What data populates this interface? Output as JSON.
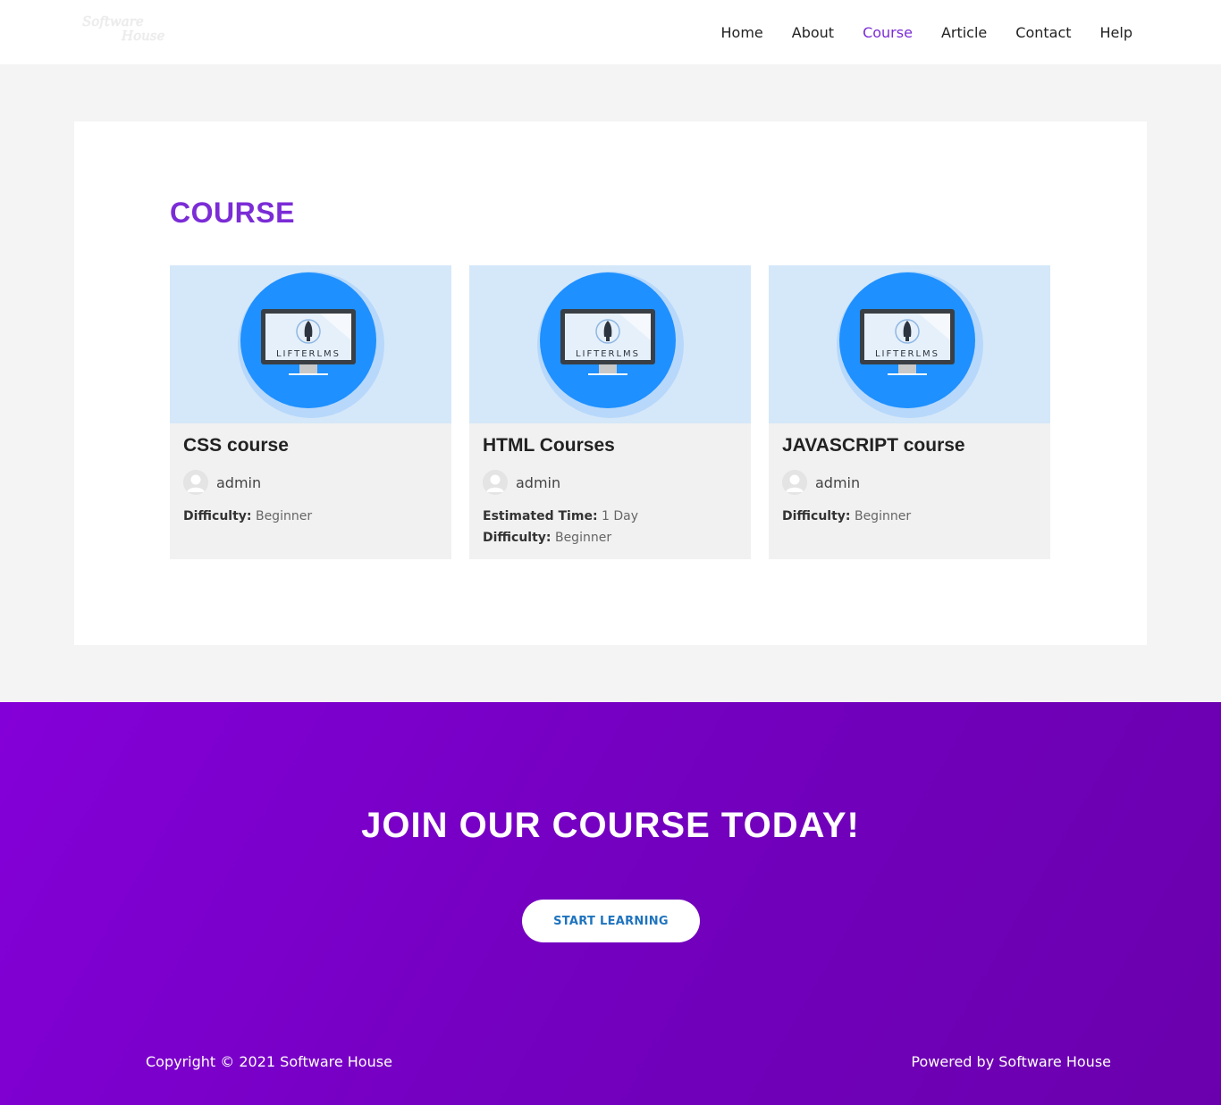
{
  "header": {
    "logo_line1": "Software",
    "logo_line2": "House",
    "nav": [
      {
        "label": "Home",
        "active": false
      },
      {
        "label": "About",
        "active": false
      },
      {
        "label": "Course",
        "active": true
      },
      {
        "label": "Article",
        "active": false
      },
      {
        "label": "Contact",
        "active": false
      },
      {
        "label": "Help",
        "active": false
      }
    ]
  },
  "page": {
    "title": "COURSE"
  },
  "courses": [
    {
      "title": "CSS course",
      "image_brand": "LIFTERLMS",
      "author": "admin",
      "meta": [
        {
          "label": "Difficulty:",
          "value": "Beginner"
        }
      ]
    },
    {
      "title": "HTML Courses",
      "image_brand": "LIFTERLMS",
      "author": "admin",
      "meta": [
        {
          "label": "Estimated Time:",
          "value": "1 Day"
        },
        {
          "label": "Difficulty:",
          "value": "Beginner"
        }
      ]
    },
    {
      "title": "JAVASCRIPT course",
      "image_brand": "LIFTERLMS",
      "author": "admin",
      "meta": [
        {
          "label": "Difficulty:",
          "value": "Beginner"
        }
      ]
    }
  ],
  "cta": {
    "heading": "JOIN OUR COURSE TODAY!",
    "button_label": "START LEARNING"
  },
  "footer": {
    "copyright": "Copyright © 2021 Software House",
    "powered_by": "Powered by Software House"
  },
  "colors": {
    "accent": "#7b2cd6",
    "cta_gradient_start": "#8400d8",
    "cta_gradient_end": "#6a00ad",
    "button_text": "#1e73be",
    "card_image_bg": "#d5e8f9",
    "icon_circle": "#1e90ff"
  }
}
